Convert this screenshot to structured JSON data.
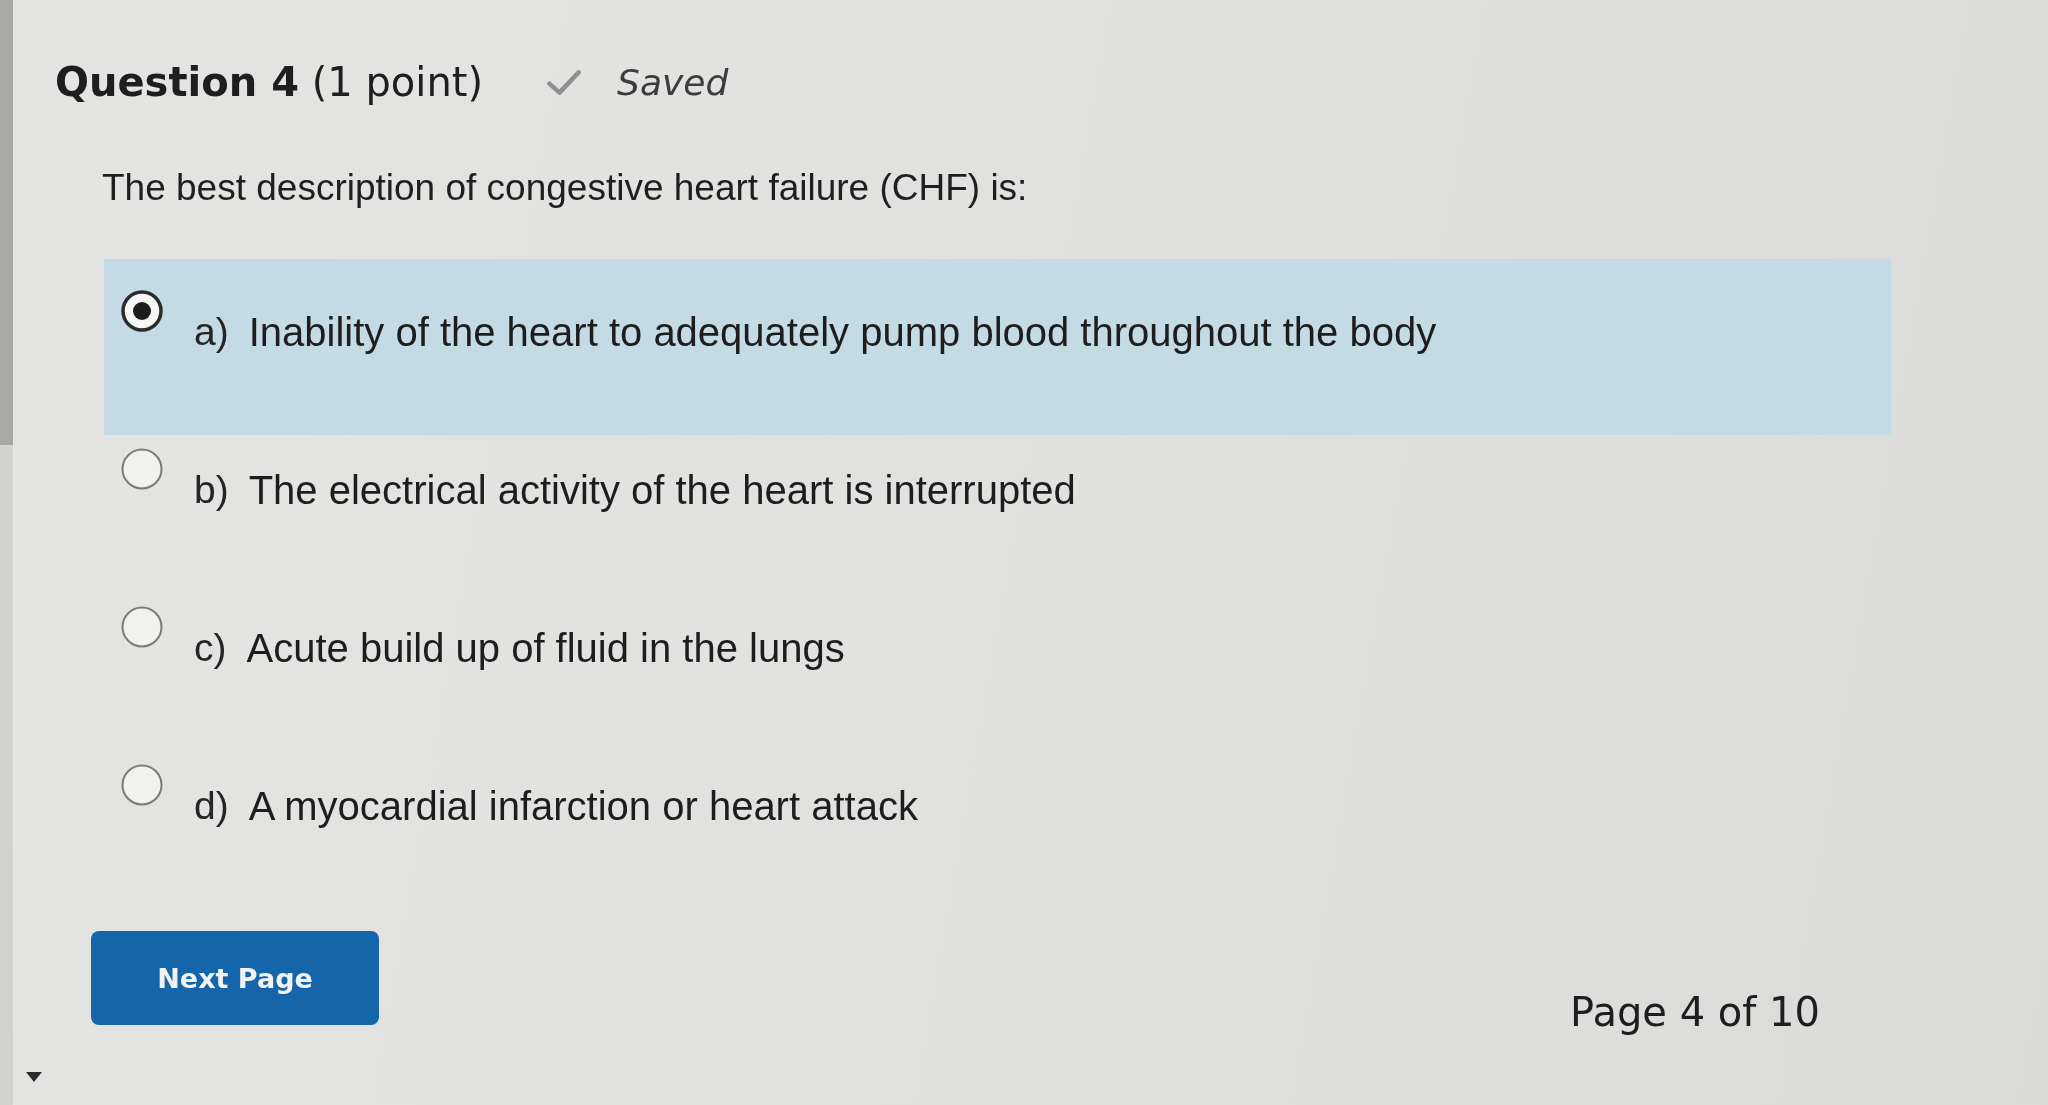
{
  "question": {
    "title": "**Question 4** (1 point)",
    "save_status": {
      "label": "Saved"
    },
    "prompt": "The best description of congestive heart failure (CHF) is:",
    "options": [
      {
        "label": "a)",
        "text": "Inability of the heart to adequately pump blood throughout the body",
        "selected": true
      },
      {
        "label": "b)",
        "text": "The electrical activity of the heart is interrupted",
        "selected": false
      },
      {
        "label": "c)",
        "text": "Acute build up of fluid in the lungs",
        "selected": false
      },
      {
        "label": "d)",
        "text": "A myocardial infarction or heart attack",
        "selected": false
      }
    ]
  },
  "footer": {
    "next_button": "Next Page",
    "page_indicator": "Page 4 of 10"
  }
}
